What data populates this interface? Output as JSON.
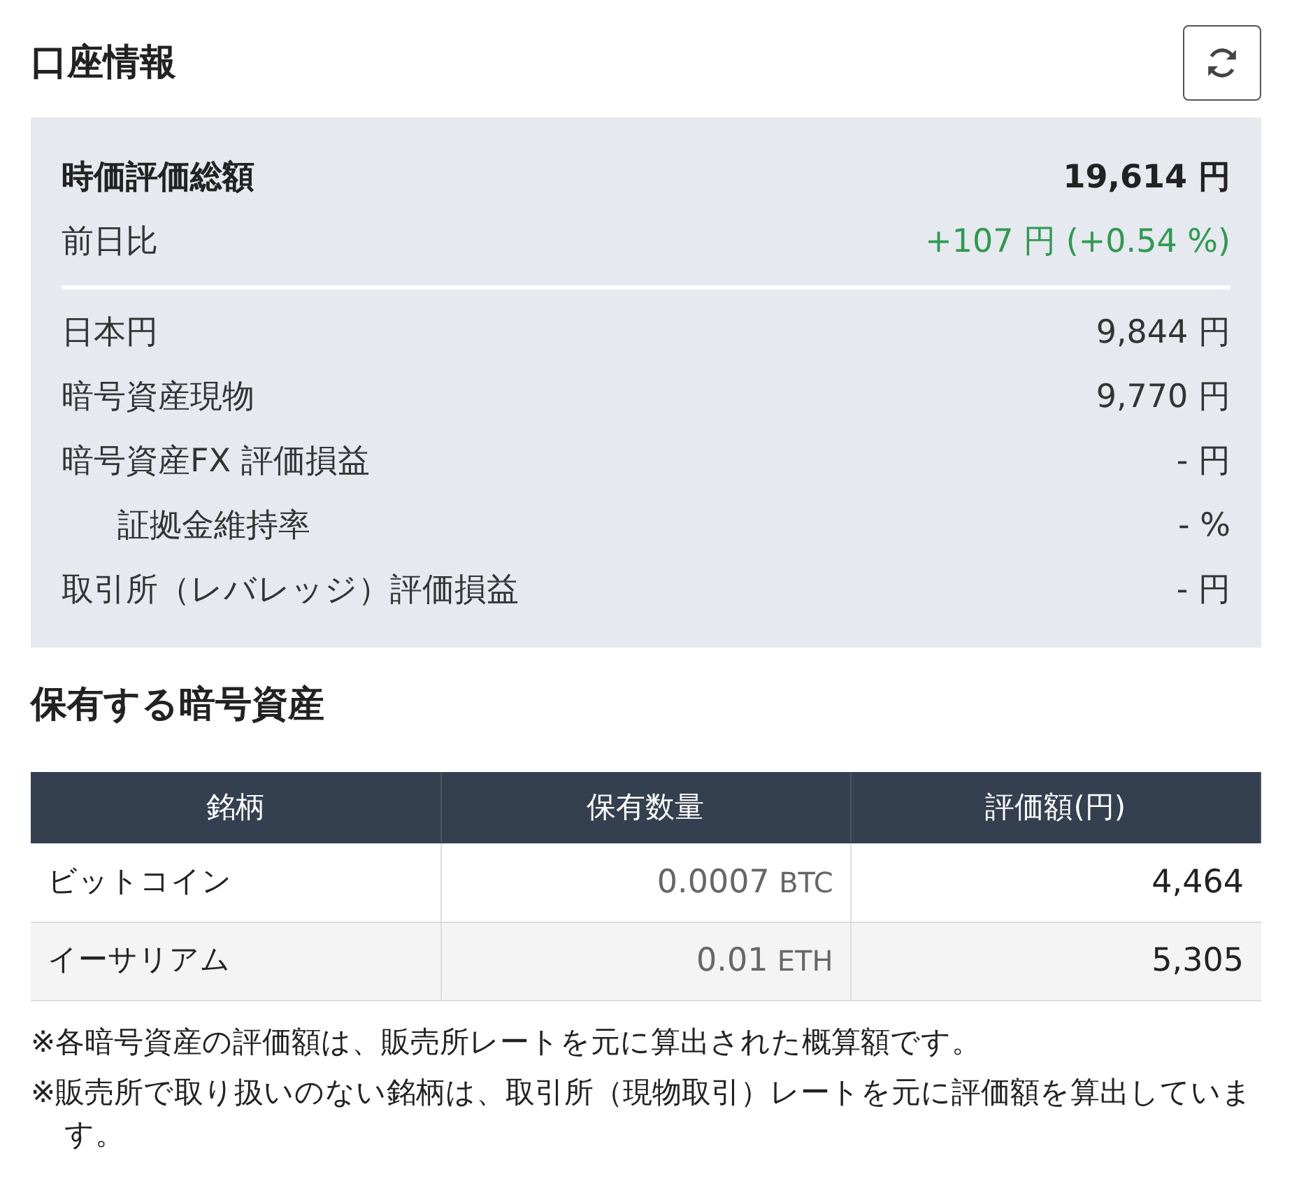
{
  "title": "口座情報",
  "summary": {
    "total": {
      "label": "時価評価総額",
      "value": "19,614 円"
    },
    "change": {
      "label": "前日比",
      "value": "+107 円 (+0.54 %)",
      "color": "#2e9a4f"
    },
    "rows": [
      {
        "label": "日本円",
        "value": "9,844 円"
      },
      {
        "label": "暗号資産現物",
        "value": "9,770 円"
      },
      {
        "label": "暗号資産FX 評価損益",
        "value": "- 円",
        "children": [
          {
            "label": "証拠金維持率",
            "value": "- %"
          }
        ]
      },
      {
        "label": "取引所（レバレッジ）評価損益",
        "value": "- 円"
      }
    ]
  },
  "holdings": {
    "title": "保有する暗号資産",
    "columns": [
      "銘柄",
      "保有数量",
      "評価額(円)"
    ],
    "rows": [
      {
        "name": "ビットコイン",
        "amount": "0.0007",
        "unit": "BTC",
        "value": "4,464"
      },
      {
        "name": "イーサリアム",
        "amount": "0.01",
        "unit": "ETH",
        "value": "5,305"
      }
    ]
  },
  "notes": [
    "※各暗号資産の評価額は、販売所レートを元に算出された概算額です。",
    "※販売所で取り扱いのない銘柄は、取引所（現物取引）レートを元に評価額を算出しています。"
  ]
}
